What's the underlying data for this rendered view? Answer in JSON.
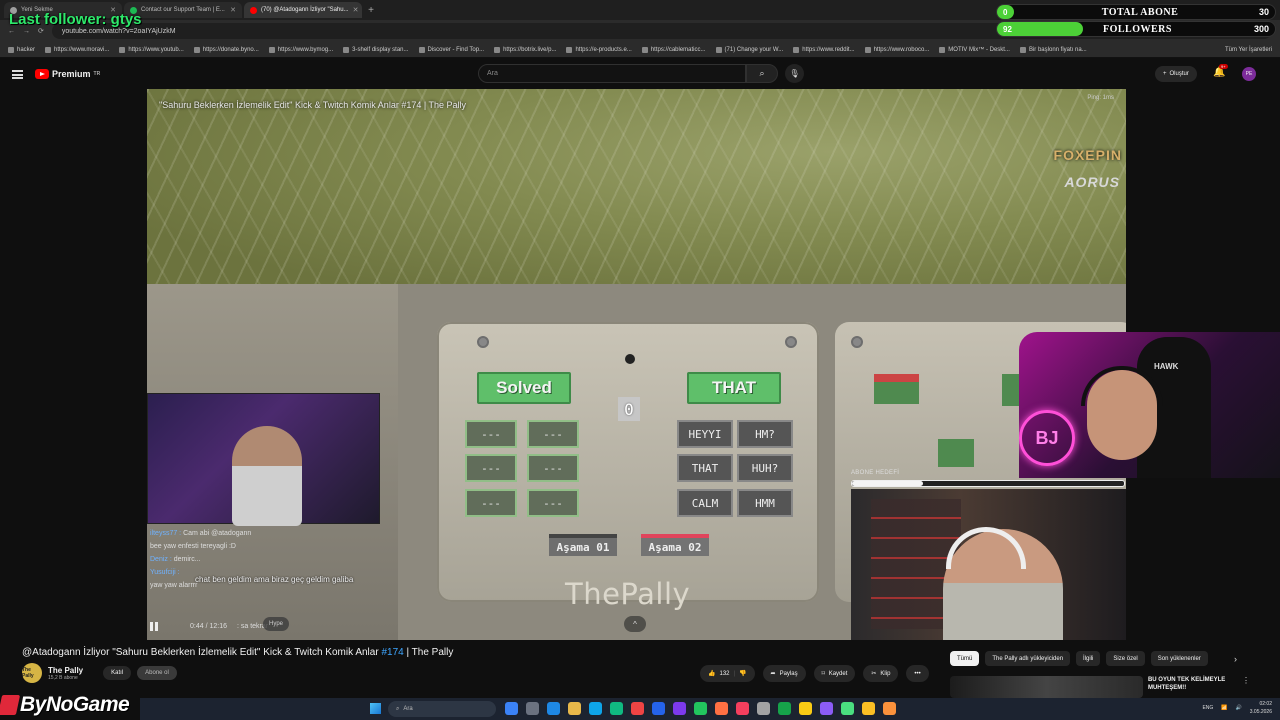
{
  "browser": {
    "tabs": [
      {
        "title": "Yeni Sekme",
        "color": "#9e9e9e"
      },
      {
        "title": "Contact our Support Team | E...",
        "color": "#1db954"
      },
      {
        "title": "(70) @Atadogann İzliyor \"Sahu...",
        "color": "#ff0000"
      }
    ],
    "new_tab": "+",
    "url": "youtube.com/watch?v=2oaIYAjUzkM",
    "bookmarks": [
      "hacker",
      "https://www.moravi...",
      "https://www.youtub...",
      "https://donate.byno...",
      "https://www.bymog...",
      "3-shelf display stan...",
      "Discover - Find Top...",
      "https://botrix.live/p...",
      "https://e-products.e...",
      "https://cablematicc...",
      "(71) Change your W...",
      "https://www.reddit...",
      "https://www.roboco...",
      "MOTIV Mix™ - Deskt...",
      "Bir başlonn fiyatı na..."
    ],
    "bookmarks_all": "Tüm Yer İşaretleri"
  },
  "overlay": {
    "last_follower": "Last follower: gtys",
    "goals": [
      {
        "label": "TOTAL ABONE",
        "current": "0",
        "target": "30",
        "progress": 0.06
      },
      {
        "label": "FOLLOWERS",
        "current": "92",
        "target": "300",
        "progress": 0.31
      }
    ],
    "bynogame": "ByNoGame",
    "abone_hedefi": "ABONE HEDEFİ",
    "abone_progress": 0.26
  },
  "youtube": {
    "logo": "Premium",
    "logo_region": "TR",
    "search_placeholder": "Ara",
    "create_label": "Oluştur",
    "notif_count": "9+",
    "avatar_text": "PE"
  },
  "video": {
    "overlay_title": "\"Sahuru Beklerken İzlemelik Edit\" Kick & Twitch Komik Anlar #174 | The Pally",
    "brand1": "FOXEPIN",
    "brand2": "AORUS",
    "ping": "Ping: 1ms",
    "game": {
      "solved": "Solved",
      "that": "THAT",
      "counter": "0",
      "dashes": [
        "---",
        "---",
        "---",
        "---",
        "---",
        "---"
      ],
      "words": [
        "HEYYI",
        "HM?",
        "THAT",
        "HUH?",
        "CALM",
        "HMM"
      ],
      "stage1": "Aşama 01",
      "stage2": "Aşama 02",
      "watermark": "ThePally"
    },
    "chat": [
      {
        "user": "ilteyss77 :",
        "msg": "Cam abi @atadogann"
      },
      {
        "user": "",
        "msg": "bee yaw enfesti tereyagli :D"
      },
      {
        "user": "Deniz :",
        "msg": "demirc..."
      },
      {
        "user": "Yusufciji :",
        "msg": ""
      },
      {
        "user": "",
        "msg": "yaw yaw alarrrr"
      }
    ],
    "chat_highlight": "chat ben geldim ama biraz geç geldim galiba",
    "chat_bottom": ": sa tekrar",
    "time": "0:44 / 12:16",
    "hype": "Hype",
    "expand": "^",
    "chair_brand": "HAWK",
    "neon": "BJ"
  },
  "below": {
    "title_prefix": "@Atadogann İzliyor \"Sahuru Beklerken İzlemelik Edit\" Kick & Twitch Komik Anlar ",
    "title_tag": "#174",
    "title_suffix": " | The Pally",
    "channel_name": "The Pally",
    "channel_subs": "15,2 B abone",
    "channel_avatar_text": "The Pally",
    "join_label": "Katıl",
    "subscribe_label": "Abone ol",
    "likes": "132",
    "share_label": "Paylaş",
    "save_label": "Kaydet",
    "clip_label": "Klip",
    "more_label": "•••"
  },
  "sidebar": {
    "chips": [
      "Tümü",
      "The Pally adlı yükleyiciden",
      "İlgili",
      "Size özel",
      "Son yüklenenler"
    ],
    "rec_title": "BU OYUN TEK KELİMEYLE MUHTEŞEM!!"
  },
  "taskbar": {
    "search": "Ara",
    "lang": "ENG",
    "time": "02:02",
    "date": "3.05.2026",
    "icons": [
      "#3b82f6",
      "#6b7280",
      "#1e88e5",
      "#e8b84a",
      "#0ea5e9",
      "#10b981",
      "#ef4444",
      "#2563eb",
      "#7c3aed",
      "#22c55e",
      "#ff7043",
      "#f43f5e",
      "#a3a3a3",
      "#16a34a",
      "#facc15",
      "#8b5cf6",
      "#4ade80",
      "#fbbf24",
      "#fb923c"
    ]
  }
}
